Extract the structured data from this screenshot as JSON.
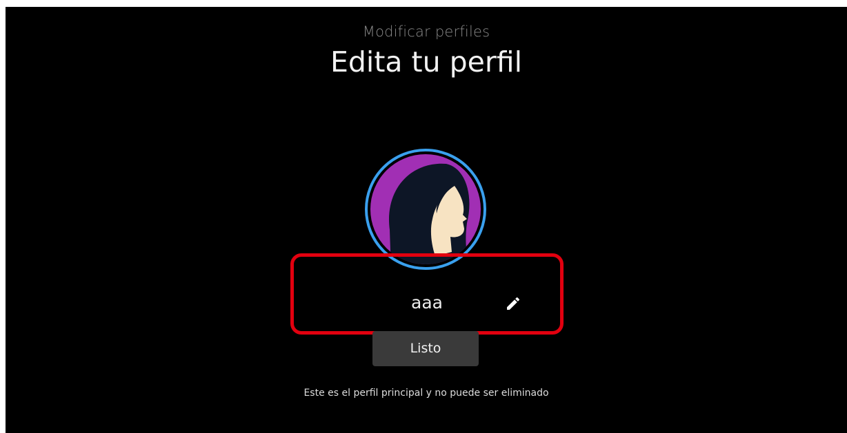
{
  "header": {
    "subtitle": "Modificar perfiles",
    "title": "Edita tu perfil"
  },
  "profile": {
    "name": "aaa",
    "avatar_icon": "profile-avatar-icon",
    "edit_icon": "pencil-icon"
  },
  "actions": {
    "done_label": "Listo"
  },
  "footer": {
    "note": "Este es el perfil principal y no puede ser eliminado"
  },
  "colors": {
    "background": "#000000",
    "highlight_border": "#e2000f",
    "avatar_ring": "#3aa0ee",
    "avatar_purple": "#a12fb4",
    "button_bg": "#3a3a3a"
  }
}
